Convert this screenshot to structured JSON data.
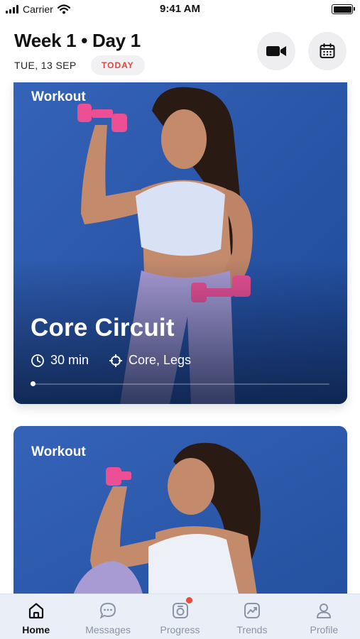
{
  "status_bar": {
    "carrier": "Carrier",
    "time": "9:41 AM"
  },
  "header": {
    "title": "Week 1 • Day 1",
    "date": "TUE, 13 SEP",
    "badge": "TODAY",
    "badge_color": "#e0473e",
    "buttons": [
      {
        "icon": "video-camera-icon"
      },
      {
        "icon": "calendar-icon"
      }
    ]
  },
  "cards": [
    {
      "label": "Workout",
      "title": "Core Circuit",
      "duration": "30 min",
      "focus": "Core, Legs",
      "duration_icon": "clock-icon",
      "focus_icon": "target-icon",
      "progress_fraction": 0.0
    },
    {
      "label": "Workout"
    }
  ],
  "tab_bar": {
    "items": [
      {
        "label": "Home",
        "icon": "home-icon",
        "active": true
      },
      {
        "label": "Messages",
        "icon": "messages-icon",
        "active": false
      },
      {
        "label": "Progress",
        "icon": "progress-icon",
        "active": false,
        "has_notification": true
      },
      {
        "label": "Trends",
        "icon": "trends-icon",
        "active": false
      },
      {
        "label": "Profile",
        "icon": "profile-icon",
        "active": false
      }
    ],
    "notification_color": "#e94b3c"
  },
  "colors": {
    "card_background": "#2b57a9",
    "tab_bar_background": "#e9eef7"
  }
}
